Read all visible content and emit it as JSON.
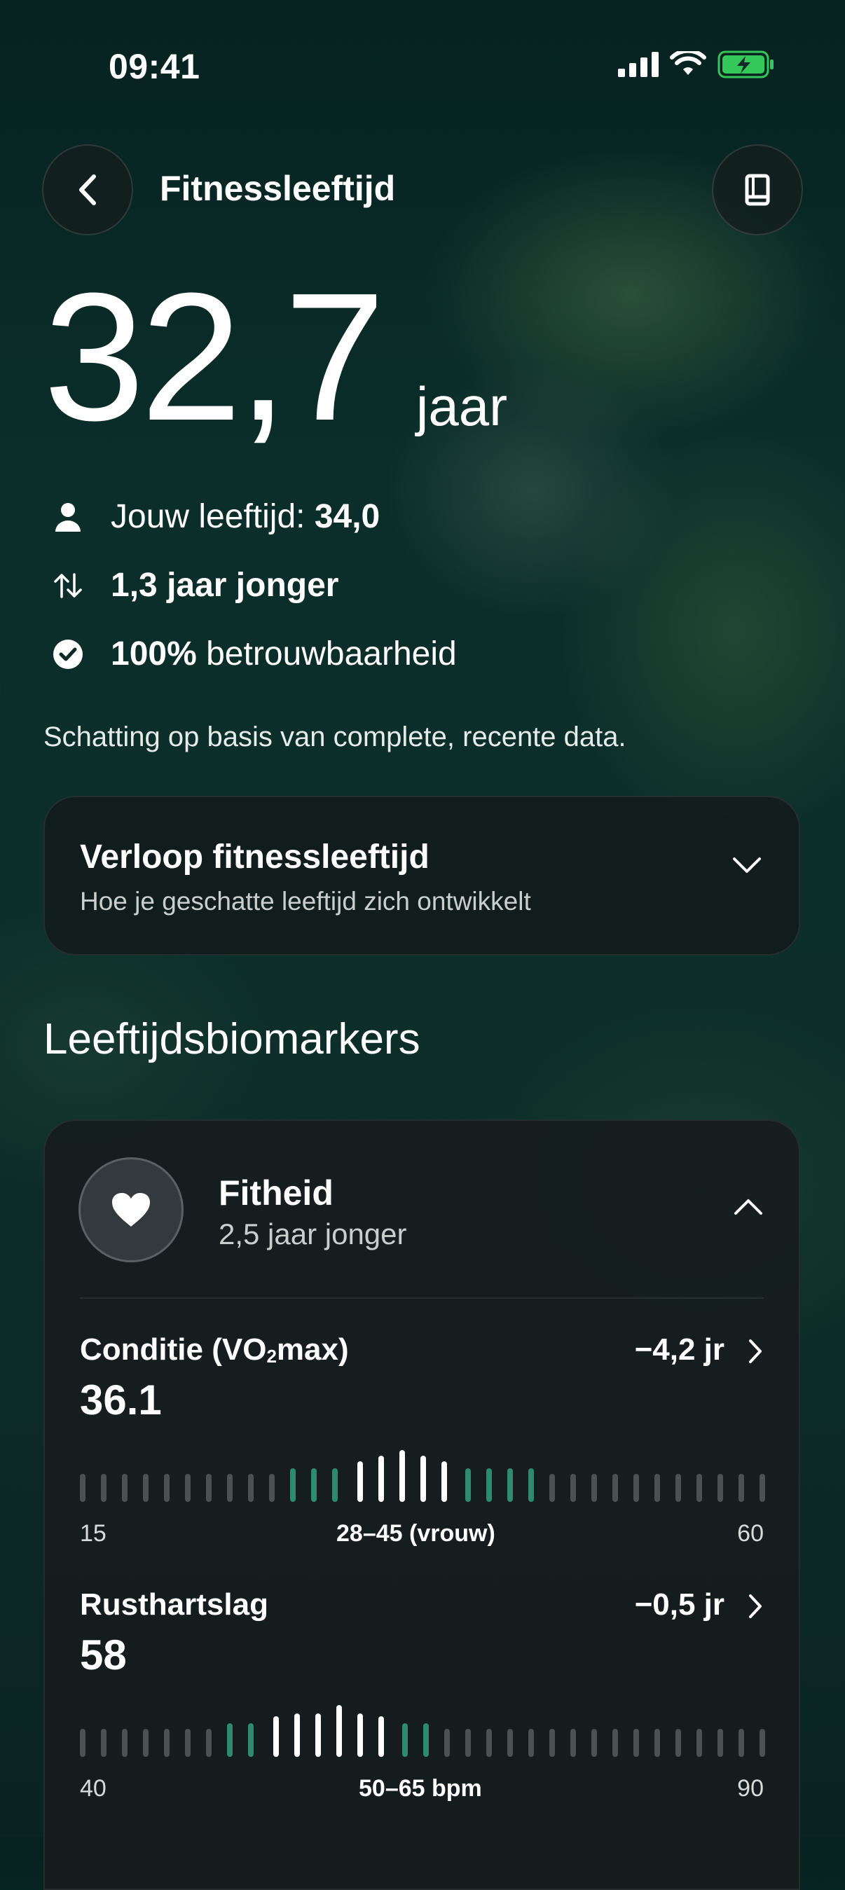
{
  "status_bar": {
    "time": "09:41"
  },
  "header": {
    "title": "Fitnessleeftijd"
  },
  "summary": {
    "age_value": "32,7",
    "age_unit": "jaar",
    "own_age_label": "Jouw leeftijd: ",
    "own_age_value": "34,0",
    "difference": "1,3 jaar jonger",
    "reliability_value": "100%",
    "reliability_label": " betrouwbaarheid",
    "note": "Schatting op basis van complete, recente data."
  },
  "trend_card": {
    "title": "Verloop fitnessleeftijd",
    "subtitle": "Hoe je geschatte leeftijd zich ontwikkelt"
  },
  "section_title": "Leeftijdsbiomarkers",
  "biomarker_category": {
    "title": "Fitheid",
    "subtitle": "2,5 jaar jonger",
    "metrics": [
      {
        "name_prefix": "Conditie (VO",
        "name_sub": "2",
        "name_suffix": "max)",
        "delta": "−4,2 jr",
        "value": "36.1",
        "scale_min": "15",
        "scale_range": "28–45 (vrouw)",
        "scale_max": "60"
      },
      {
        "name": "Rusthartslag",
        "delta": "−0,5 jr",
        "value": "58",
        "scale_min": "40",
        "scale_range": "50–65 bpm",
        "scale_max": "90"
      }
    ]
  },
  "colors": {
    "accent_green": "#2f8b6e",
    "battery_green": "#34c759",
    "card_bg": "#1a2224"
  },
  "icons": [
    "chevron-left-icon",
    "book-icon",
    "person-icon",
    "arrows-updown-icon",
    "checkmark-circle-icon",
    "chevron-down-icon",
    "heart-icon",
    "chevron-up-icon",
    "chevron-right-icon"
  ]
}
